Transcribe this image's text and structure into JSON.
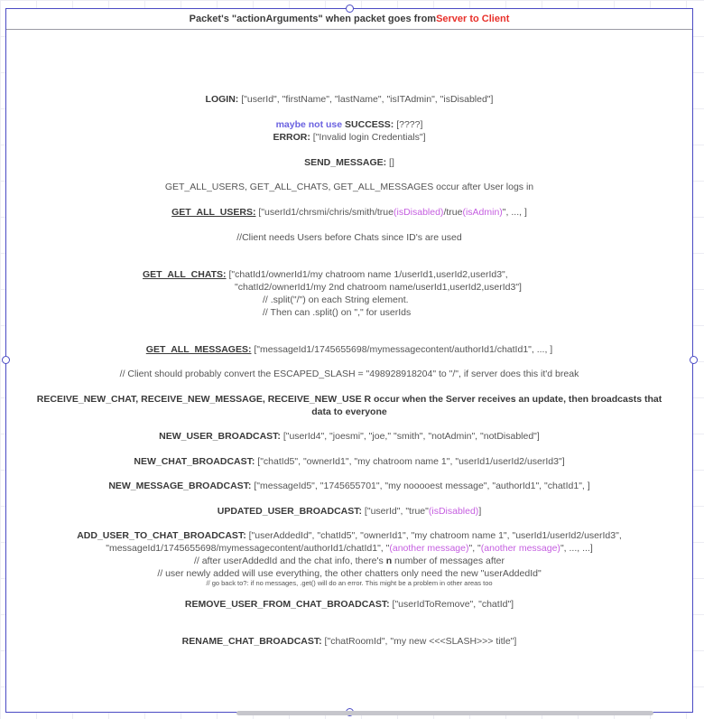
{
  "header": {
    "title_pre": "Packet's \"actionArguments\" when packet goes from ",
    "title_highlight": "Server to Client"
  },
  "colors": {
    "frame": "#4a4ac4",
    "red": "#e8302a",
    "purple": "#6b62e0",
    "green": "#28a02e",
    "magenta": "#c55ee0",
    "text": "#555555"
  },
  "lines": {
    "login_key": "LOGIN:",
    "login_val": " [\"userId\", \"firstName\", \"lastName\", \"isITAdmin\", \"isDisabled\"]",
    "success_note": "maybe not use ",
    "success_key": "SUCCESS:",
    "success_val": " [????]",
    "error_key": "ERROR:",
    "error_val": " [\"Invalid login Credentials\"]",
    "send_key": "SEND_MESSAGE:",
    "send_val": " []",
    "get_all_heading": "GET_ALL_USERS, GET_ALL_CHATS, GET_ALL_MESSAGES occur after User logs in",
    "users_key": "GET_ALL_USERS:",
    "users_val_a": "  [\"userId1/chrsmi/chris/smith/true",
    "users_val_b": "(isDisabled)",
    "users_val_c": "/true",
    "users_val_d": "(isAdmin)",
    "users_val_e": "\", ..., ]",
    "client_comment": "//Client needs Users before Chats since ID's are used",
    "chats_key": "GET_ALL_CHATS:",
    "chats_val_1": " [\"chatId1/ownerId1/my chatroom name 1/userId1,userId2,userId3\",",
    "chats_val_2": "\"chatId2/ownerId1/my 2nd chatroom name/userId1,userId2,userId3\"]",
    "chats_val_3": "// .split(\"/\") on each String element.",
    "chats_val_4": "// Then can .split() on \",\" for userIds",
    "messages_key": "GET_ALL_MESSAGES:",
    "messages_val": " [\"messageId1/1745655698/mymessagecontent/authorId1/chatId1\",  ..., ]",
    "escaped_comment": "// Client should probably convert the ESCAPED_SLASH = \"498928918204\" to \"/\", if server does this it'd break",
    "receive_1": "RECEIVE_NEW_CHAT, RECEIVE_NEW_MESSAGE, RECEIVE_NEW_USE R occur when the Server receives an update, then broadcasts that",
    "receive_2": "data to everyone",
    "new_user_key": "NEW_USER_BROADCAST:",
    "new_user_val": " [\"userId4\", \"joesmi\", \"joe,\" \"smith\", \"notAdmin\", \"notDisabled\"]",
    "new_chat_key": "NEW_CHAT_BROADCAST:",
    "new_chat_val": " [\"chatId5\", \"ownerId1\", \"my chatroom name 1\", \"userId1/userId2/userId3\"]",
    "new_msg_key": "NEW_MESSAGE_BROADCAST:",
    "new_msg_val": " [\"messageId5\", \"1745655701\", \"my nooooest message\", \"authorId1\", \"chatId1\", ]",
    "updated_key": "UPDATED_USER_BROADCAST:",
    "updated_val_a": " [\"userId\", \"true\"",
    "updated_val_b": "(isDisabled)",
    "updated_val_c": "]",
    "add_key": "ADD_USER_TO_CHAT_BROADCAST:",
    "add_val_1": " [\"userAddedId\",  \"chatId5\", \"ownerId1\", \"my chatroom name 1\", \"userId1/userId2/userId3\",",
    "add_val_2a": "\"messageId1/1745655698/mymessagecontent/authorId1/chatId1\",  \"",
    "add_val_2b": "(another message)",
    "add_val_2c": "\", \"",
    "add_val_2d": "(another message)",
    "add_val_2e": "\",  ..., ...]",
    "add_val_3a": "// after userAddedId and the chat info, there's ",
    "add_val_3b": "n",
    "add_val_3c": " number of messages after",
    "add_val_4": "// user newly added will use everything, the other chatters only need the new \"userAddedId\"",
    "add_val_5": "// go back to?: if no messages, .get() will do an error. This might be a problem in other areas too",
    "remove_key": "REMOVE_USER_FROM_CHAT_BROADCAST:",
    "remove_val": " [\"userIdToRemove\", \"chatId\"]",
    "rename_key": "RENAME_CHAT_BROADCAST:",
    "rename_val": " [\"chatRoomId\", \"my new <<<SLASH>>> title\"]"
  }
}
